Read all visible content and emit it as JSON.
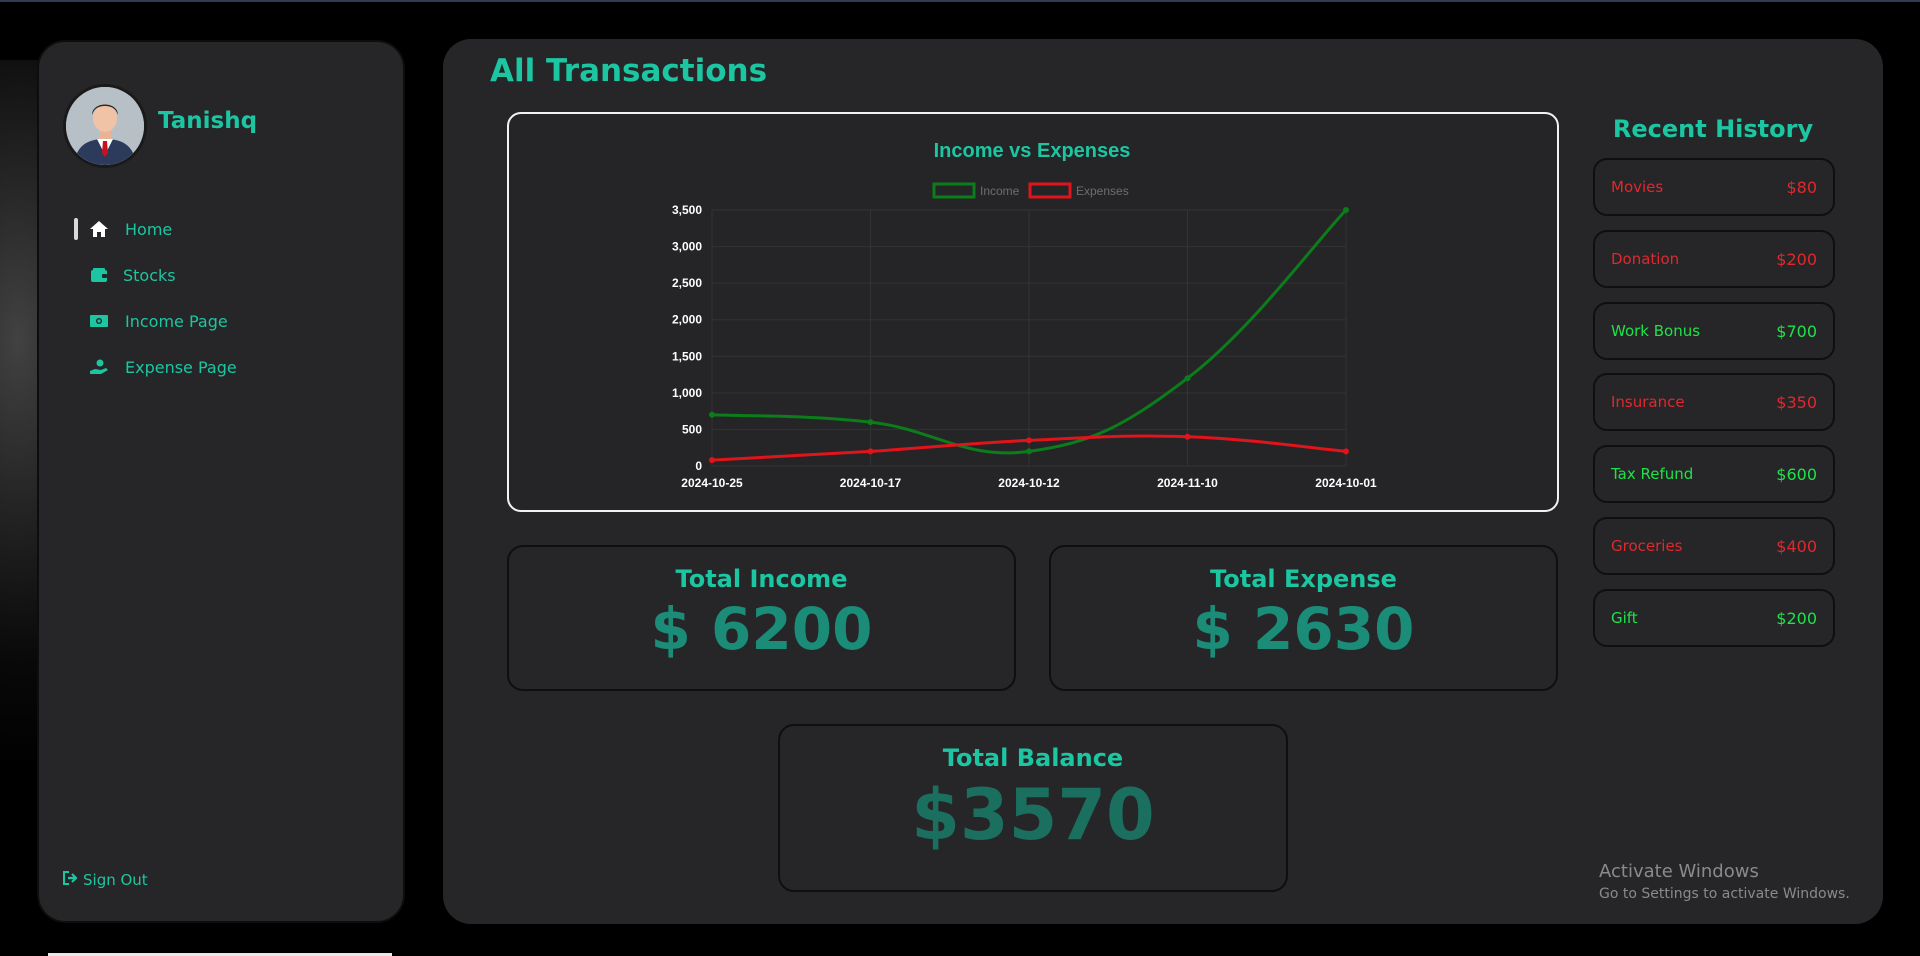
{
  "user": {
    "name": "Tanishq"
  },
  "sidebar": {
    "items": [
      {
        "label": "Home",
        "icon": "home-icon",
        "active": true
      },
      {
        "label": "Stocks",
        "icon": "wallet-icon",
        "active": false
      },
      {
        "label": "Income Page",
        "icon": "money-icon",
        "active": false
      },
      {
        "label": "Expense Page",
        "icon": "hand-coin-icon",
        "active": false
      }
    ],
    "signout_label": "Sign Out"
  },
  "main": {
    "title": "All Transactions"
  },
  "chart_data": {
    "type": "line",
    "title": "Income vs Expenses",
    "categories": [
      "2024-10-25",
      "2024-10-17",
      "2024-10-12",
      "2024-11-10",
      "2024-10-01"
    ],
    "series": [
      {
        "name": "Income",
        "color": "#0b7d1a",
        "values": [
          700,
          600,
          200,
          1200,
          3500
        ]
      },
      {
        "name": "Expenses",
        "color": "#e0141a",
        "values": [
          80,
          200,
          350,
          400,
          200
        ]
      }
    ],
    "yticks": [
      0,
      500,
      1000,
      1500,
      2000,
      2500,
      3000,
      3500
    ],
    "ytick_labels": [
      "0",
      "500",
      "1,000",
      "1,500",
      "2,000",
      "2,500",
      "3,000",
      "3,500"
    ],
    "ylim": [
      0,
      3500
    ],
    "legend": "top-center",
    "grid": true,
    "xlabel": "",
    "ylabel": ""
  },
  "totals": {
    "income": {
      "title": "Total Income",
      "value": "$ 6200"
    },
    "expense": {
      "title": "Total Expense",
      "value": "$ 2630"
    },
    "balance": {
      "title": "Total Balance",
      "value": "$3570"
    }
  },
  "recent": {
    "title": "Recent History",
    "items": [
      {
        "name": "Movies",
        "amount": "$80",
        "type": "expense"
      },
      {
        "name": "Donation",
        "amount": "$200",
        "type": "expense"
      },
      {
        "name": "Work Bonus",
        "amount": "$700",
        "type": "income"
      },
      {
        "name": "Insurance",
        "amount": "$350",
        "type": "expense"
      },
      {
        "name": "Tax Refund",
        "amount": "$600",
        "type": "income"
      },
      {
        "name": "Groceries",
        "amount": "$400",
        "type": "expense"
      },
      {
        "name": "Gift",
        "amount": "$200",
        "type": "income"
      }
    ]
  },
  "watermark": {
    "line1": "Activate Windows",
    "line2": "Go to Settings to activate Windows."
  }
}
